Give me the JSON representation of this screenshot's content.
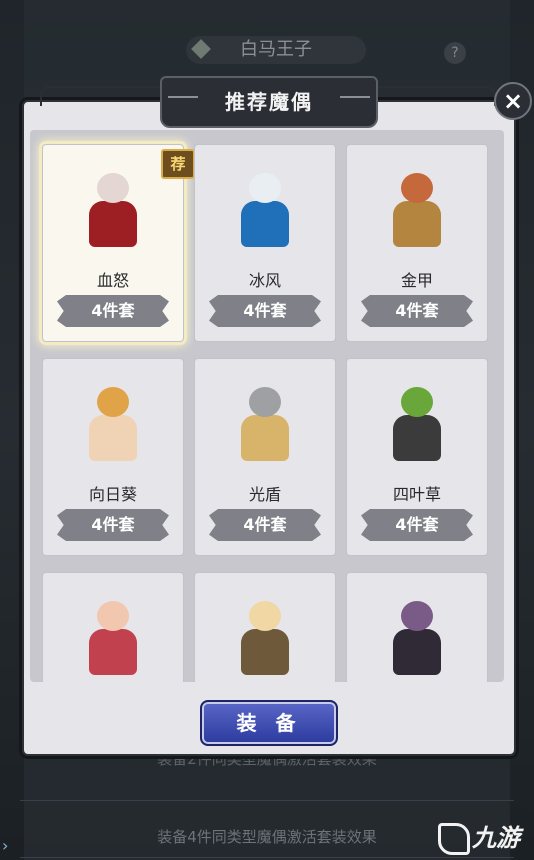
{
  "background": {
    "title": "白马王子",
    "help_icon": "?",
    "desc_top": "装备2件同类型魔偶激活套装效果",
    "desc_bottom": "装备4件同类型魔偶激活套装效果"
  },
  "watermark": {
    "icon": "九游-logo",
    "text": "九游"
  },
  "modal": {
    "title": "推荐魔偶",
    "close_icon": "×",
    "recommended_tag": "荐",
    "equip_label": "装 备",
    "cards": [
      {
        "name": "血怒",
        "set": "4件套",
        "selected": true,
        "colors": [
          "#e4d6d3",
          "#9e1f23"
        ]
      },
      {
        "name": "冰风",
        "set": "4件套",
        "selected": false,
        "colors": [
          "#e9eef2",
          "#1f6fb9"
        ]
      },
      {
        "name": "金甲",
        "set": "4件套",
        "selected": false,
        "colors": [
          "#c5683b",
          "#b3853f"
        ]
      },
      {
        "name": "向日葵",
        "set": "4件套",
        "selected": false,
        "colors": [
          "#e0a347",
          "#efd3b4"
        ]
      },
      {
        "name": "光盾",
        "set": "4件套",
        "selected": false,
        "colors": [
          "#9ea0a3",
          "#d8b46a"
        ]
      },
      {
        "name": "四叶草",
        "set": "4件套",
        "selected": false,
        "colors": [
          "#6aa73a",
          "#3b3b3b"
        ]
      },
      {
        "name": "",
        "set": "",
        "selected": false,
        "colors": [
          "#f2c7b0",
          "#c2414f"
        ]
      },
      {
        "name": "",
        "set": "",
        "selected": false,
        "colors": [
          "#f1d7a4",
          "#6e5a3a"
        ]
      },
      {
        "name": "",
        "set": "",
        "selected": false,
        "colors": [
          "#7a5a86",
          "#2f2a36"
        ]
      }
    ]
  }
}
